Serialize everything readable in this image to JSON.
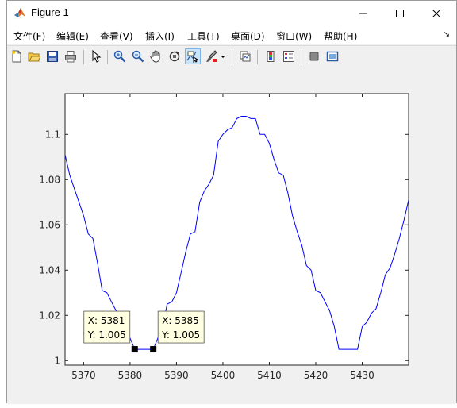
{
  "window": {
    "title": "Figure 1"
  },
  "menu": [
    {
      "label": "文件(F)"
    },
    {
      "label": "编辑(E)"
    },
    {
      "label": "查看(V)"
    },
    {
      "label": "插入(I)"
    },
    {
      "label": "工具(T)"
    },
    {
      "label": "桌面(D)"
    },
    {
      "label": "窗口(W)"
    },
    {
      "label": "帮助(H)"
    }
  ],
  "toolbar": [
    {
      "icon": "new-figure-icon"
    },
    {
      "icon": "open-file-icon"
    },
    {
      "icon": "save-icon"
    },
    {
      "icon": "print-icon"
    },
    {
      "icon": "edit-plot-arrow-icon"
    },
    {
      "icon": "zoom-in-icon"
    },
    {
      "icon": "zoom-out-icon"
    },
    {
      "icon": "pan-hand-icon"
    },
    {
      "icon": "rotate-3d-icon"
    },
    {
      "icon": "data-cursor-icon",
      "active": true
    },
    {
      "icon": "brush-icon"
    },
    {
      "icon": "link-plot-icon"
    },
    {
      "icon": "colorbar-icon"
    },
    {
      "icon": "legend-icon"
    },
    {
      "icon": "hide-plot-tools-icon"
    },
    {
      "icon": "show-plot-tools-icon"
    }
  ],
  "colors": {
    "line": "#0000ff",
    "datatip_bg": "#ffffe1",
    "axes_bg": "#ffffff",
    "figure_bg": "#f0f0f0"
  },
  "chart_data": {
    "type": "line",
    "xlim": [
      5366,
      5440
    ],
    "ylim": [
      0.998,
      1.118
    ],
    "xticks": [
      5370,
      5380,
      5390,
      5400,
      5410,
      5420,
      5430
    ],
    "yticks": [
      1,
      1.02,
      1.04,
      1.06,
      1.08,
      1.1
    ],
    "ytick_labels": [
      "1",
      "1.02",
      "1.04",
      "1.06",
      "1.08",
      "1.1"
    ],
    "grid": false,
    "series": [
      {
        "color": "#0000ff",
        "x": [
          5366,
          5367,
          5368,
          5369,
          5370,
          5371,
          5372,
          5373,
          5374,
          5375,
          5376,
          5377,
          5378,
          5379,
          5380,
          5381,
          5382,
          5383,
          5384,
          5385,
          5386,
          5387,
          5388,
          5389,
          5390,
          5391,
          5392,
          5393,
          5394,
          5395,
          5396,
          5397,
          5398,
          5399,
          5400,
          5401,
          5402,
          5403,
          5404,
          5405,
          5406,
          5407,
          5408,
          5409,
          5410,
          5411,
          5412,
          5413,
          5414,
          5415,
          5416,
          5417,
          5418,
          5419,
          5420,
          5421,
          5422,
          5423,
          5424,
          5425,
          5426,
          5427,
          5428,
          5429,
          5430,
          5431,
          5432,
          5433,
          5434,
          5435,
          5436,
          5437,
          5438,
          5439,
          5440
        ],
        "y": [
          1.091,
          1.082,
          1.076,
          1.07,
          1.064,
          1.056,
          1.054,
          1.043,
          1.031,
          1.03,
          1.026,
          1.022,
          1.02,
          1.014,
          1.01,
          1.005,
          1.005,
          1.005,
          1.005,
          1.005,
          1.01,
          1.015,
          1.025,
          1.026,
          1.03,
          1.039,
          1.048,
          1.056,
          1.057,
          1.07,
          1.075,
          1.078,
          1.082,
          1.097,
          1.1,
          1.102,
          1.103,
          1.107,
          1.108,
          1.108,
          1.107,
          1.107,
          1.1,
          1.1,
          1.096,
          1.089,
          1.083,
          1.082,
          1.074,
          1.064,
          1.057,
          1.051,
          1.042,
          1.04,
          1.031,
          1.03,
          1.026,
          1.022,
          1.015,
          1.005,
          1.005,
          1.005,
          1.005,
          1.005,
          1.015,
          1.017,
          1.021,
          1.023,
          1.03,
          1.038,
          1.041,
          1.047,
          1.054,
          1.062,
          1.071
        ]
      }
    ],
    "datatips": [
      {
        "x_label": "X: 5381",
        "y_label": "Y: 1.005",
        "x": 5381,
        "y": 1.005,
        "side": "left"
      },
      {
        "x_label": "X: 5385",
        "y_label": "Y: 1.005",
        "x": 5385,
        "y": 1.005,
        "side": "right"
      }
    ]
  }
}
